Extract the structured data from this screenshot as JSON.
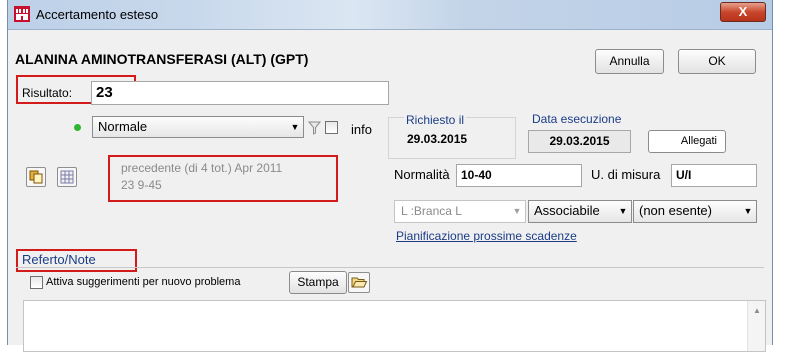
{
  "window": {
    "title": "Accertamento esteso",
    "close_label": "X"
  },
  "header": {
    "test_name": "ALANINA AMINOTRANSFERASI (ALT) (GPT)",
    "cancel_label": "Annulla",
    "ok_label": "OK"
  },
  "risultato": {
    "label": "Risultato:",
    "value": "23"
  },
  "esito": {
    "selected": "Normale",
    "info_label": "info"
  },
  "previous": {
    "line1": "precedente (di 4 tot.) Apr 2011",
    "line2": "23 9-45"
  },
  "richiesto": {
    "label": "Richiesto il",
    "date": "29.03.2015"
  },
  "esecuzione": {
    "label": "Data esecuzione",
    "date": "29.03.2015"
  },
  "allegati_label": "Allegati",
  "normalita": {
    "label": "Normalità",
    "value": "10-40"
  },
  "misura": {
    "label": "U. di misura",
    "value": "U/I"
  },
  "branca": {
    "selected": "L :Branca L"
  },
  "associabile": {
    "selected": "Associabile"
  },
  "esenzione": {
    "selected": "(non esente)"
  },
  "pianificazione_label": "Pianificazione prossime scadenze",
  "referto": {
    "label": "Referto/Note",
    "suggest_label": "Attiva suggerimenti per nuovo problema",
    "stampa_label": "Stampa"
  },
  "colors": {
    "status_dot": "#2fb52f",
    "highlight": "#d31b1b",
    "link": "#1b3c86"
  }
}
